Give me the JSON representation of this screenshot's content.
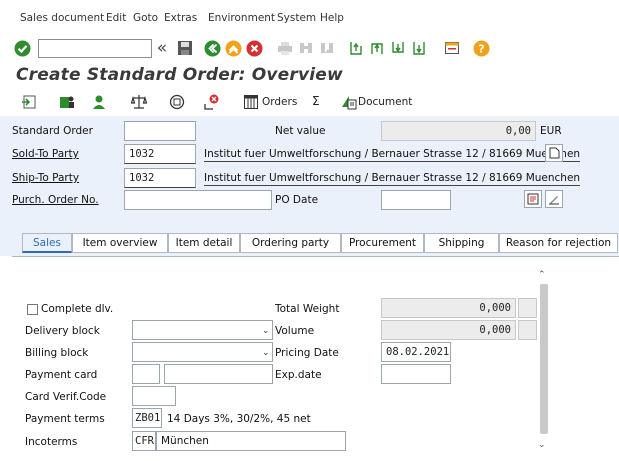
{
  "menu": [
    "Sales document",
    "Edit",
    "Goto",
    "Extras",
    "Environment",
    "System",
    "Help"
  ],
  "toolbar": {
    "back_symbol": "«",
    "icons": [
      "enter-icon",
      "save-icon",
      "back-icon",
      "exit-icon",
      "cancel-icon",
      "print-icon",
      "find-icon",
      "find-next-icon",
      "first-page-icon",
      "prev-page-icon",
      "next-page-icon",
      "last-page-icon",
      "create-session-icon",
      "help-icon"
    ]
  },
  "title": "Create Standard Order: Overview",
  "apptoolbar": {
    "orders_label": "Orders",
    "sigma": "Σ",
    "document_label": "Document"
  },
  "header": {
    "standard_order_label": "Standard Order",
    "standard_order_value": "",
    "net_value_label": "Net value",
    "net_value": "0,00",
    "currency": "EUR",
    "sold_to_label": "Sold-To Party",
    "sold_to_value": "1032",
    "sold_to_desc": "Institut fuer Umweltforschung / Bernauer Strasse 12 / 81669 Muenchen",
    "ship_to_label": "Ship-To Party",
    "ship_to_value": "1032",
    "ship_to_desc": "Institut fuer Umweltforschung / Bernauer Strasse 12 / 81669 Muenchen",
    "po_label": "Purch. Order No.",
    "po_value": "",
    "po_date_label": "PO Date",
    "po_date_value": ""
  },
  "tabs": [
    "Sales",
    "Item overview",
    "Item detail",
    "Ordering party",
    "Procurement",
    "Shipping",
    "Reason for rejection"
  ],
  "sales": {
    "complete_dlv_label": "Complete dlv.",
    "total_weight_label": "Total Weight",
    "total_weight": "0,000",
    "delivery_block_label": "Delivery block",
    "volume_label": "Volume",
    "volume": "0,000",
    "billing_block_label": "Billing block",
    "pricing_date_label": "Pricing Date",
    "pricing_date": "08.02.2021",
    "payment_card_label": "Payment card",
    "exp_date_label": "Exp.date",
    "card_verif_label": "Card Verif.Code",
    "payment_terms_label": "Payment terms",
    "payment_terms_code": "ZB01",
    "payment_terms_desc": "14 Days 3%, 30/2%, 45 net",
    "incoterms_label": "Incoterms",
    "incoterms_code": "CFR",
    "incoterms_place": "München"
  }
}
